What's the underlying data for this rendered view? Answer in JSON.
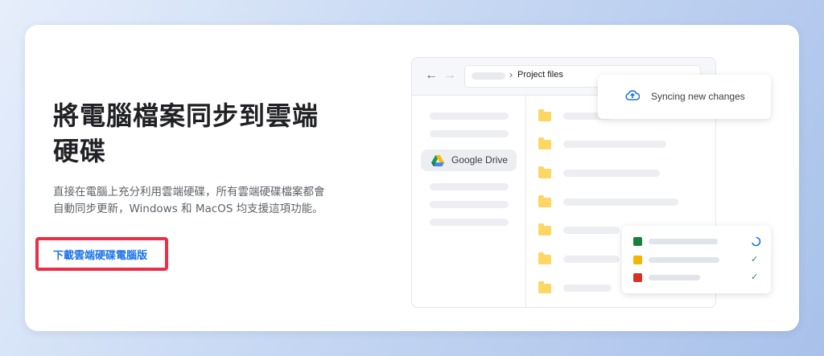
{
  "hero": {
    "title": "將電腦檔案同步到雲端硬碟",
    "description": "直接在電腦上充分利用雲端硬碟，所有雲端硬碟檔案都會自動同步更新，Windows 和 MacOS 均支援這項功能。",
    "download_link": "下載雲端硬碟電腦版"
  },
  "drive_window": {
    "path_label": "Project files",
    "sidebar_chip_label": "Google Drive"
  },
  "sync_toast": {
    "label": "Syncing new changes"
  },
  "file_status": {
    "items": [
      {
        "icon": "sheets-icon",
        "status": "syncing"
      },
      {
        "icon": "slides-icon",
        "status": "synced"
      },
      {
        "icon": "image-icon",
        "status": "synced"
      }
    ]
  },
  "colors": {
    "accent_blue": "#1a73e8",
    "highlight_red": "#ea3047",
    "folder_yellow": "#fdd663",
    "check_green": "#1e8e3e"
  }
}
